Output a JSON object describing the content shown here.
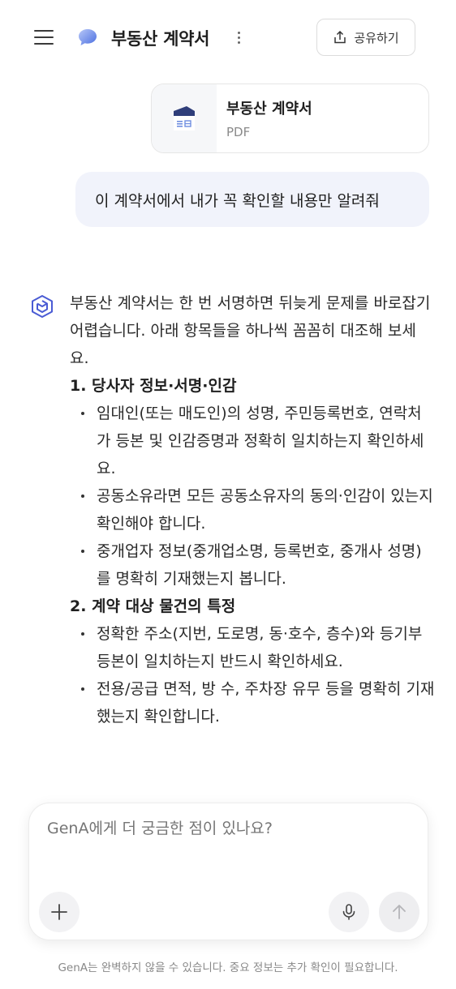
{
  "header": {
    "title": "부동산 계약서",
    "share_label": "공유하기"
  },
  "attachment": {
    "name": "부동산 계약서",
    "type": "PDF"
  },
  "user_message": "이 계약서에서 내가 꼭 확인할 내용만 알려줘",
  "assistant": {
    "intro": "부동산 계약서는 한 번 서명하면 뒤늦게 문제를 바로잡기 어렵습니다. 아래 항목들을 하나씩 꼼꼼히 대조해 보세요.",
    "sections": [
      {
        "title": "1. 당사자 정보·서명·인감",
        "bullets": [
          "임대인(또는 매도인)의 성명, 주민등록번호, 연락처가 등본 및 인감증명과 정확히 일치하는지 확인하세요.",
          "공동소유라면 모든 공동소유자의 동의·인감이 있는지 확인해야 합니다.",
          "중개업자 정보(중개업소명, 등록번호, 중개사 성명)를 명확히 기재했는지 봅니다."
        ]
      },
      {
        "title": "2. 계약 대상 물건의 특정",
        "bullets": [
          "정확한 주소(지번, 도로명, 동·호수, 층수)와 등기부등본이 일치하는지 반드시 확인하세요.",
          "전용/공급 면적, 방 수, 주차장 유무 등을 명확히 기재했는지 확인합니다."
        ]
      }
    ]
  },
  "composer": {
    "placeholder": "GenA에게 더 궁금한 점이 있나요?"
  },
  "disclaimer": "GenA는 완벽하지 않을 수 있습니다. 중요 정보는 추가 확인이 필요합니다.",
  "colors": {
    "accent": "#4a5bd4",
    "user_bubble": "#f1f3fb"
  }
}
